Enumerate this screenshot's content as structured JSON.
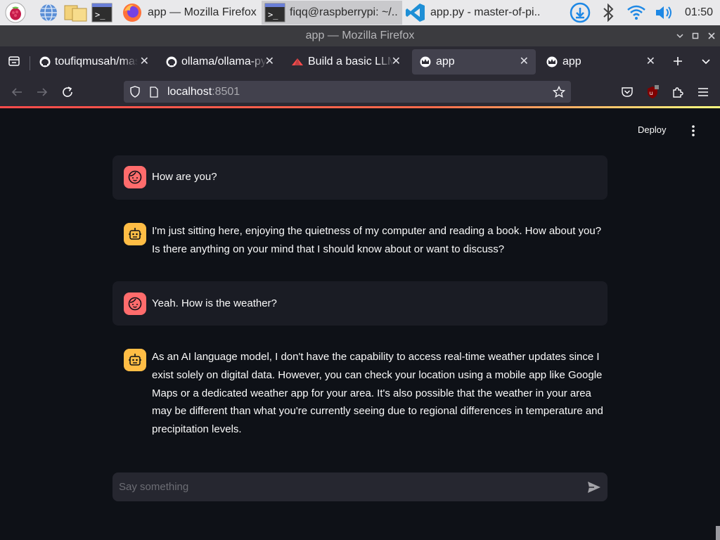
{
  "taskbar": {
    "tasks": [
      {
        "label": "app — Mozilla Firefox"
      },
      {
        "label": "fiqq@raspberrypi: ~/.."
      },
      {
        "label": "app.py - master-of-pi.."
      }
    ],
    "clock": "01:50"
  },
  "window": {
    "title": "app — Mozilla Firefox"
  },
  "tabs": [
    {
      "label": "toufiqmusah/master-of-pi",
      "icon": "github-icon"
    },
    {
      "label": "ollama/ollama-python",
      "icon": "github-icon"
    },
    {
      "label": "Build a basic LLM chat app",
      "icon": "streamlit-icon"
    },
    {
      "label": "app",
      "icon": "streamlit-crown-icon",
      "active": true
    },
    {
      "label": "app",
      "icon": "streamlit-crown-icon"
    }
  ],
  "urlbar": {
    "host": "localhost",
    "port": ":8501"
  },
  "app": {
    "deploy_label": "Deploy",
    "messages": [
      {
        "role": "user",
        "text": "How are you?"
      },
      {
        "role": "assistant",
        "text": "I'm just sitting here, enjoying the quietness of my computer and reading a book. How about you? Is there anything on your mind that I should know about or want to discuss?"
      },
      {
        "role": "user",
        "text": "Yeah. How is the weather?"
      },
      {
        "role": "assistant",
        "text": "As an AI language model, I don't have the capability to access real-time weather updates since I exist solely on digital data. However, you can check your location using a mobile app like Google Maps or a dedicated weather app for your area. It's also possible that the weather in your area may be different than what you're currently seeing due to regional differences in temperature and precipitation levels."
      }
    ],
    "input_placeholder": "Say something"
  },
  "colors": {
    "accent": "#ff4b4b",
    "user_avatar": "#ff6c6c",
    "bot_avatar": "#ffbd45",
    "background": "#0e1117"
  }
}
